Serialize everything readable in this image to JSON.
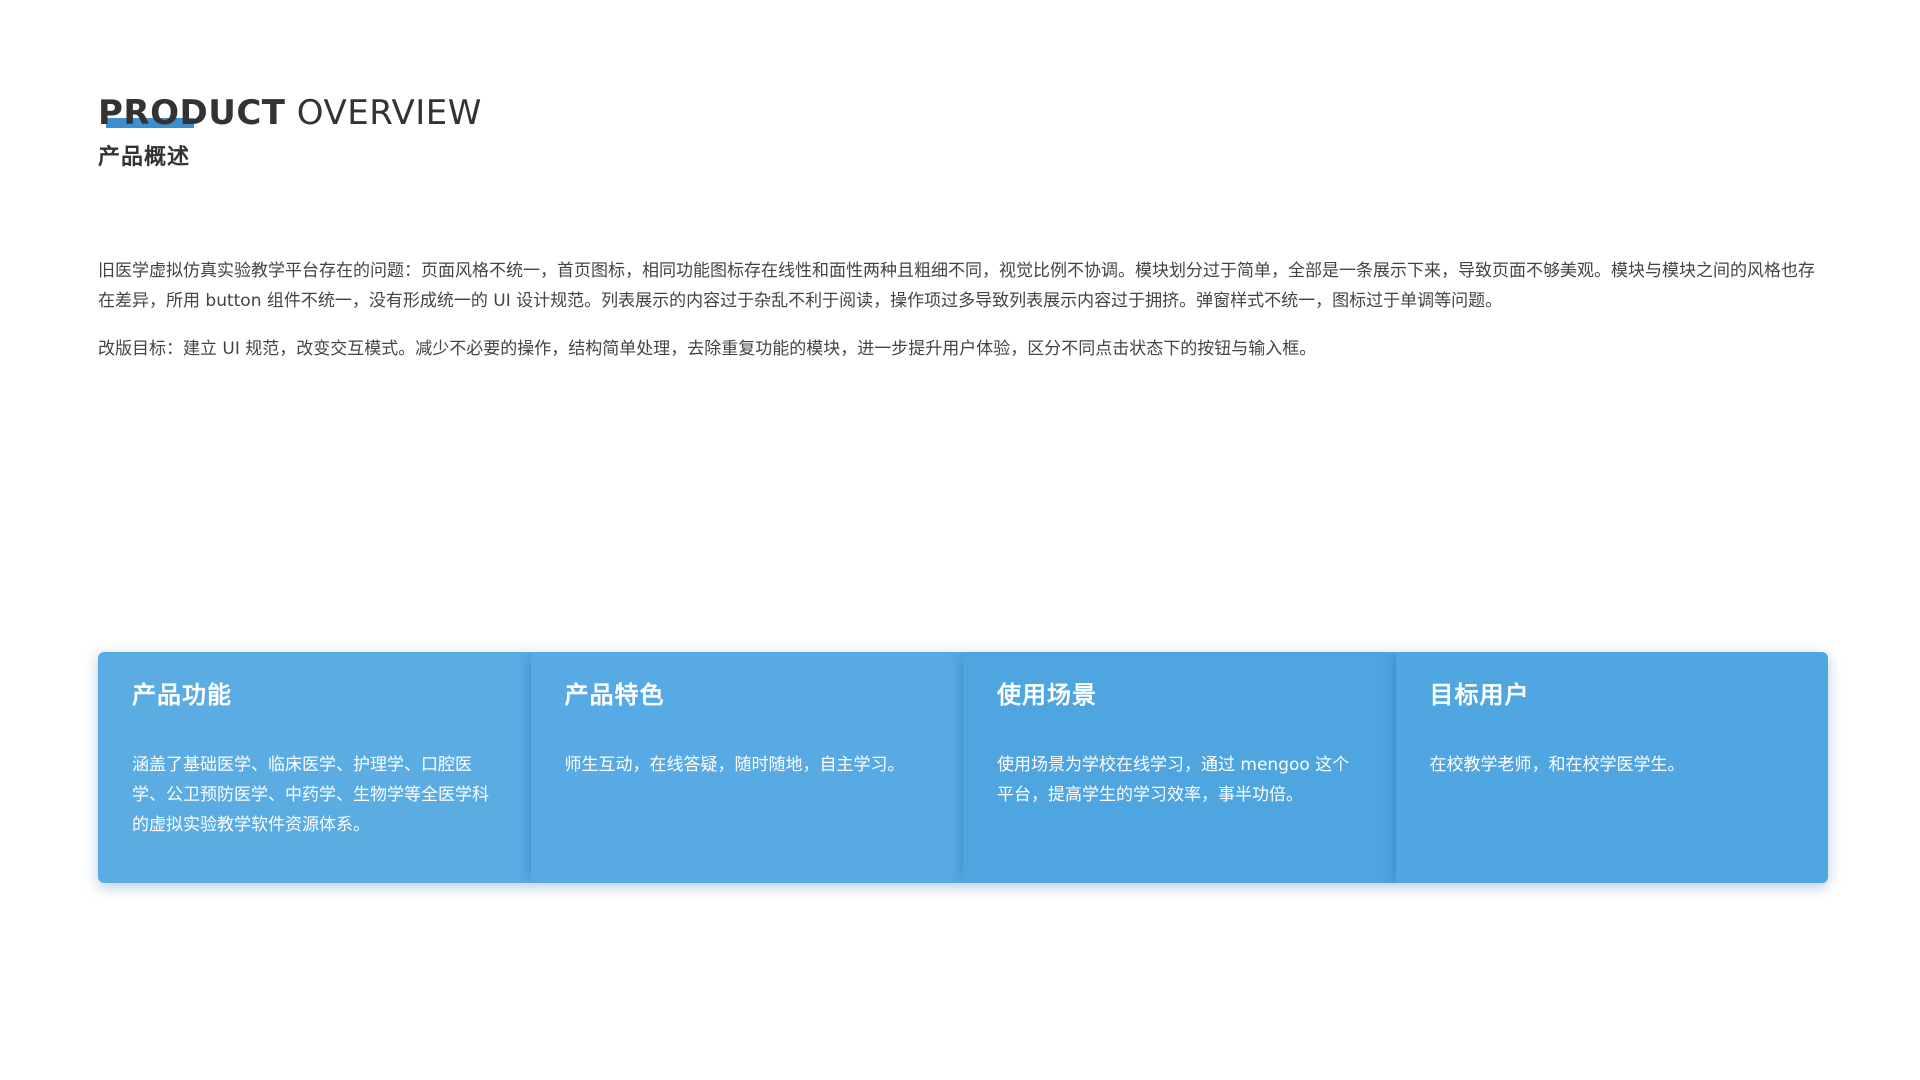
{
  "header": {
    "title_bold": "PRODUCT",
    "title_light": " OVERVIEW",
    "subtitle": "产品概述"
  },
  "intro": {
    "problem": "旧医学虚拟仿真实验教学平台存在的问题：页面风格不统一，首页图标，相同功能图标存在线性和面性两种且粗细不同，视觉比例不协调。模块划分过于简单，全部是一条展示下来，导致页面不够美观。模块与模块之间的风格也存在差异，所用 button 组件不统一，没有形成统一的 UI 设计规范。列表展示的内容过于杂乱不利于阅读，操作项过多导致列表展示内容过于拥挤。弹窗样式不统一，图标过于单调等问题。",
    "goal": "改版目标：建立 UI 规范，改变交互模式。减少不必要的操作，结构简单处理，去除重复功能的模块，进一步提升用户体验，区分不同点击状态下的按钮与输入框。"
  },
  "cards": [
    {
      "title": "产品功能",
      "desc": "涵盖了基础医学、临床医学、护理学、口腔医学、公卫预防医学、中药学、生物学等全医学科的虚拟实验教学软件资源体系。",
      "color": "#5aace3"
    },
    {
      "title": "产品特色",
      "desc": "师生互动，在线答疑，随时随地，自主学习。",
      "color": "#57aae3"
    },
    {
      "title": "使用场景",
      "desc": "使用场景为学校在线学习，通过 mengoo 这个平台，提高学生的学习效率，事半功倍。",
      "color": "#4ea5e0"
    },
    {
      "title": "目标用户",
      "desc": "在校教学老师，和在校学医学生。",
      "color": "#4fa6e1"
    }
  ],
  "colors": {
    "accent": "#3d8fd0",
    "text": "#333333"
  }
}
